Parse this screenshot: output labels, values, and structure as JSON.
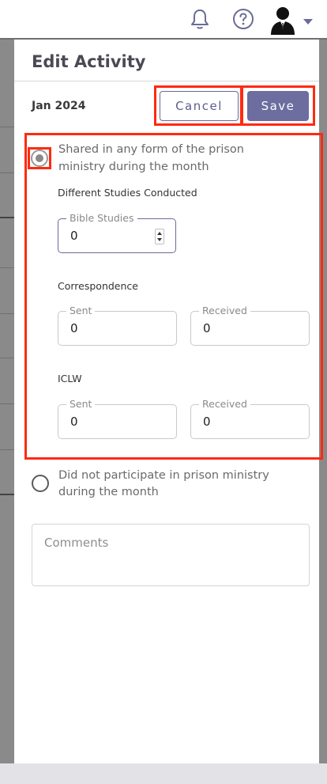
{
  "topbar": {
    "icons": [
      "bell-icon",
      "help-icon",
      "user-avatar",
      "chevron-down-icon"
    ],
    "accent": "#6b6b9a"
  },
  "drawer": {
    "title": "Edit Activity",
    "month": "Jan 2024",
    "cancel_label": "Cancel",
    "save_label": "Save"
  },
  "option_shared": {
    "label_line1": "Shared in any form of the prison",
    "label_line2": "ministry during the month",
    "selected": true
  },
  "studies": {
    "heading": "Different Studies Conducted",
    "bible_label": "Bible Studies",
    "bible_value": "0"
  },
  "correspondence": {
    "heading": "Correspondence",
    "sent_label": "Sent",
    "sent_value": "0",
    "received_label": "Received",
    "received_value": "0"
  },
  "iclw": {
    "heading": "ICLW",
    "sent_label": "Sent",
    "sent_value": "0",
    "received_label": "Received",
    "received_value": "0"
  },
  "option_not": {
    "label_line1": "Did not participate in prison ministry",
    "label_line2": "during the month",
    "selected": false
  },
  "comments": {
    "placeholder": "Comments"
  },
  "colors": {
    "highlight": "#ff2a10",
    "primary": "#6d6da0"
  }
}
